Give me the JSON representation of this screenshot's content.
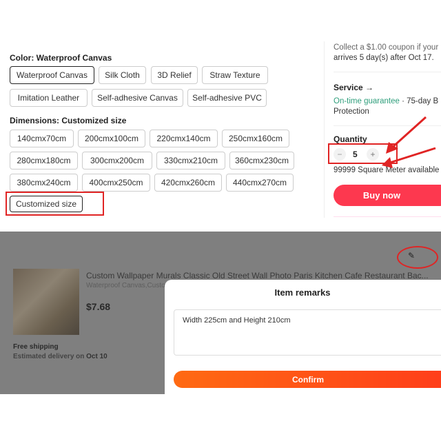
{
  "color": {
    "label": "Color: Waterproof Canvas",
    "options": [
      "Waterproof Canvas",
      "Silk Cloth",
      "3D Relief",
      "Straw Texture",
      "Imitation Leather",
      "Self-adhesive Canvas",
      "Self-adhesive PVC"
    ],
    "selected": "Waterproof Canvas"
  },
  "dimensions": {
    "label": "Dimensions: Customized size",
    "options": [
      "140cmx70cm",
      "200cmx100cm",
      "220cmx140cm",
      "250cmx160cm",
      "280cmx180cm",
      "300cmx200cm",
      "330cmx210cm",
      "360cmx230cm",
      "380cmx240cm",
      "400cmx250cm",
      "420cmx260cm",
      "440cmx270cm",
      "Customized size"
    ],
    "selected": "Customized size"
  },
  "side": {
    "coupon_line": "Collect a $1.00 coupon if your",
    "arrival_line": "arrives 5 day(s) after Oct 17.",
    "service_label": "Service →",
    "guarantee": "On-time guarantee",
    "guarantee_rest": " · 75-day B",
    "protection": "Protection",
    "quantity_label": "Quantity",
    "quantity": "5",
    "minus": "−",
    "plus": "+",
    "available": "99999 Square Meter available",
    "buy_now": "Buy now"
  },
  "cart": {
    "title": "Custom Wallpaper Murals Classic Old Street Wall Photo Paris Kitchen Cafe Restaurant Bac...",
    "variant": "Waterproof Canvas,Custo",
    "price": "$7.68",
    "shipping": "Free shipping",
    "delivery_prefix": "Estimated delivery on ",
    "delivery_date": "Oct 10"
  },
  "modal": {
    "title": "Item remarks",
    "remark": "Width 225cm and Height 210cm",
    "confirm": "Confirm"
  },
  "colors": {
    "accent": "#fd384f",
    "guarantee": "#2e9e7b",
    "confirm_start": "#ff6a13",
    "confirm_end": "#ff3d1a",
    "annotation": "#e02424"
  }
}
